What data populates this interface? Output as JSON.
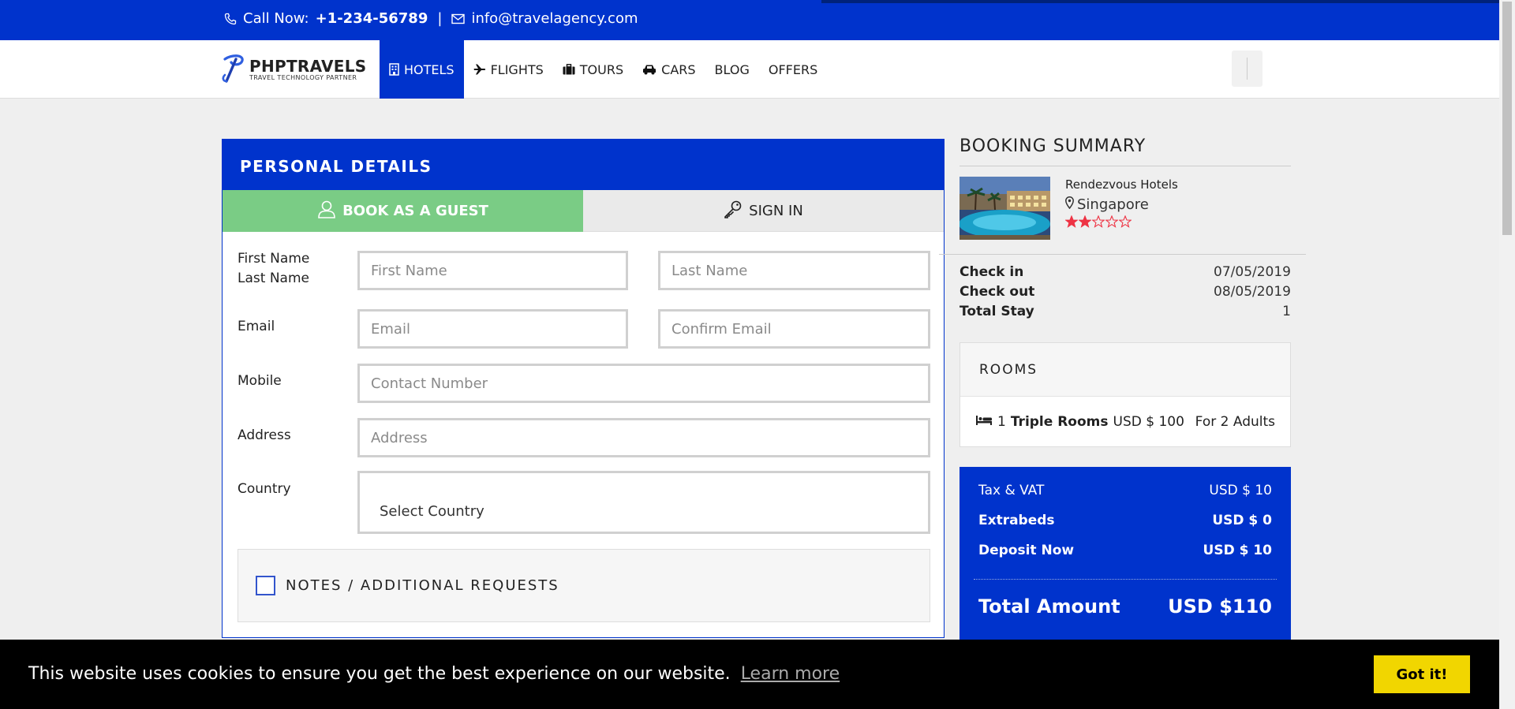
{
  "topbar": {
    "call_label": "Call Now:",
    "phone": "+1-234-56789",
    "separator": "|",
    "email": "info@travelagency.com"
  },
  "brand": {
    "name": "PHPTRAVELS",
    "tagline": "TRAVEL TECHNOLOGY PARTNER"
  },
  "nav": {
    "items": [
      {
        "label": "HOTELS",
        "icon": "building-icon",
        "active": true
      },
      {
        "label": "FLIGHTS",
        "icon": "plane-icon",
        "active": false
      },
      {
        "label": "TOURS",
        "icon": "suitcase-icon",
        "active": false
      },
      {
        "label": "CARS",
        "icon": "car-icon",
        "active": false
      },
      {
        "label": "BLOG",
        "icon": "",
        "active": false
      },
      {
        "label": "OFFERS",
        "icon": "",
        "active": false
      }
    ]
  },
  "personal_details": {
    "title": "PERSONAL DETAILS",
    "tab_guest": "BOOK AS A GUEST",
    "tab_signin": "SIGN IN",
    "labels": {
      "first_name": "First Name",
      "last_name": "Last Name",
      "email": "Email",
      "mobile": "Mobile",
      "address": "Address",
      "country": "Country"
    },
    "placeholders": {
      "first_name": "First Name",
      "last_name": "Last Name",
      "email": "Email",
      "confirm_email": "Confirm Email",
      "mobile": "Contact Number",
      "address": "Address"
    },
    "country_selected": "Select Country",
    "notes_label": "NOTES / ADDITIONAL REQUESTS"
  },
  "summary": {
    "title": "BOOKING SUMMARY",
    "hotel_name": "Rendezvous Hotels",
    "location": "Singapore",
    "rating": 2,
    "rating_max": 5,
    "check_in_label": "Check in",
    "check_in": "07/05/2019",
    "check_out_label": "Check out",
    "check_out": "08/05/2019",
    "total_stay_label": "Total Stay",
    "total_stay": "1",
    "rooms_title": "ROOMS",
    "room_count": "1",
    "room_type": "Triple Rooms",
    "room_price": "USD $ 100",
    "room_guests": "For 2 Adults",
    "tax_label": "Tax & VAT",
    "tax_value": "USD $ 10",
    "extrabeds_label": "Extrabeds",
    "extrabeds_value": "USD $ 0",
    "deposit_label": "Deposit Now",
    "deposit_value": "USD $ 10",
    "total_label": "Total Amount",
    "total_value": "USD $110"
  },
  "cookie": {
    "message": "This website uses cookies to ensure you get the best experience on our website.",
    "learn_more": "Learn more",
    "button": "Got it!"
  },
  "colors": {
    "primary": "#0033cc",
    "guest_tab": "#7acc85",
    "star": "#ee3344",
    "cookie_button": "#f1d600"
  }
}
